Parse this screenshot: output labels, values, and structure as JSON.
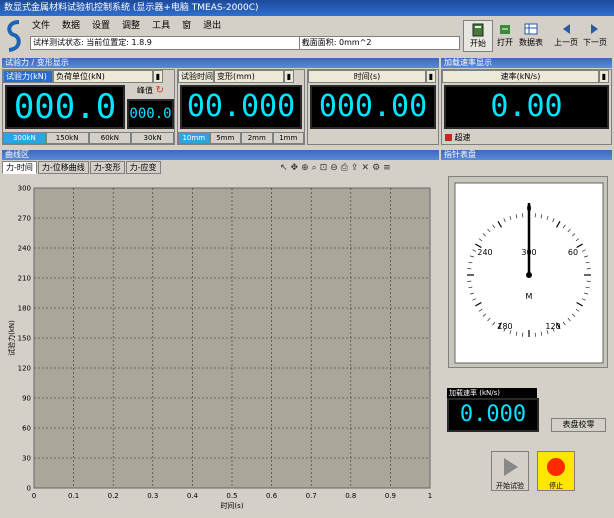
{
  "window": {
    "title": "数显式金属材料试验机控制系统  (显示器+电脑 TMEAS-2000C)"
  },
  "menu": [
    "文件",
    "数据",
    "设置",
    "调整",
    "工具",
    "窗",
    "退出"
  ],
  "info": {
    "test_no": "试样测试状态: 当前位置定: 1.8.9",
    "area": "截面面积: 0mm^2"
  },
  "toolbar": [
    {
      "label": "开始",
      "icon": "calculator-icon"
    },
    {
      "label": "打开",
      "icon": "open-icon"
    },
    {
      "label": "数据表",
      "icon": "table-icon"
    },
    {
      "label": "上一页",
      "icon": "prev-icon"
    },
    {
      "label": "下一页",
      "icon": "next-icon"
    }
  ],
  "force_panel": {
    "header": "试验力 / 变形显示",
    "load_label": "试验力(kN)",
    "load_unit": "负荷单位(kN)",
    "peak_label": "峰值",
    "main_value": "000.0",
    "peak_value": "000.0",
    "ranges": [
      "300kN",
      "150kN",
      "60kN",
      "30kN"
    ],
    "selected_range": 0
  },
  "displacement_panel": {
    "label1": "试验时间",
    "label2": "变形(mm)",
    "value": "00.000",
    "ranges": [
      "10mm",
      "5mm",
      "2mm",
      "1mm"
    ],
    "selected_range": 0
  },
  "time_panel": {
    "label": "时间(s)",
    "value": "000.00"
  },
  "rate_panel": {
    "header": "加载速率显示",
    "label": "速率(kN/s)",
    "value": "0.00",
    "status": "超速"
  },
  "curve_panel": {
    "header": "曲线区",
    "tabs": [
      "力-时间",
      "力-位移曲线",
      "力-变形",
      "力-应变"
    ],
    "selected_tab": 0,
    "toolbar_icons": [
      "pointer-icon",
      "hand-icon",
      "zoom-icon",
      "search-icon",
      "fit-icon",
      "zoom-out-icon",
      "print-icon",
      "export-icon",
      "delete-icon",
      "settings-icon",
      "legend-icon"
    ]
  },
  "chart_data": {
    "type": "line",
    "xlabel": "时间(s)",
    "ylabel": "试验力(kN)",
    "xlim": [
      0,
      1
    ],
    "ylim": [
      0,
      300
    ],
    "x_ticks": [
      "0",
      "0.1",
      "0.2",
      "0.3",
      "0.4",
      "0.5",
      "0.6",
      "0.7",
      "0.8",
      "0.9",
      "1"
    ],
    "y_ticks": [
      "0",
      "30",
      "60",
      "90",
      "120",
      "150",
      "180",
      "210",
      "240",
      "270",
      "300"
    ],
    "series": []
  },
  "dial_panel": {
    "header": "指针表盘",
    "labels": [
      "0",
      "60",
      "120",
      "180",
      "240",
      "300"
    ],
    "center_label": "M",
    "angle_label": "加载速率 (kN/s)",
    "value": "0.000",
    "reset_button": "表盘校零"
  },
  "actions": {
    "start": "开始试验",
    "stop": "停止"
  },
  "colors": {
    "lcd_text": "#00e5ff",
    "chart_bg": "#aaa79a",
    "accent": "#2d6bd0",
    "stop": "#ff2a00",
    "stop_bg": "#ffe600"
  }
}
